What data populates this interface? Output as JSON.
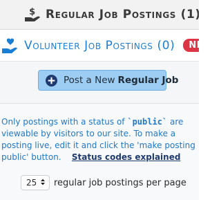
{
  "tabs": {
    "regular": {
      "label": "Regular Job Postings (1)",
      "icon": "hand-dollar-icon"
    },
    "volunteer": {
      "label": "Volunteer Job Postings (0)",
      "icon": "hand-heart-icon",
      "badge": "NEW"
    }
  },
  "actions": {
    "post_prefix": "Post a New",
    "post_bold": "Regular Job",
    "icon": "plus-circle-icon"
  },
  "info": {
    "text_before": "Only postings with a status of ",
    "status_code": "`public`",
    "text_after": " are viewable by visitors to our site. To make a posting live, edit it and click the 'make posting public' button.",
    "link": "Status codes explained"
  },
  "per_page": {
    "value": "25",
    "suffix": "regular job postings per page"
  },
  "colors": {
    "accent": "#1a7fd4",
    "badge": "#dc3545",
    "button_bg": "#9ecdf3"
  }
}
